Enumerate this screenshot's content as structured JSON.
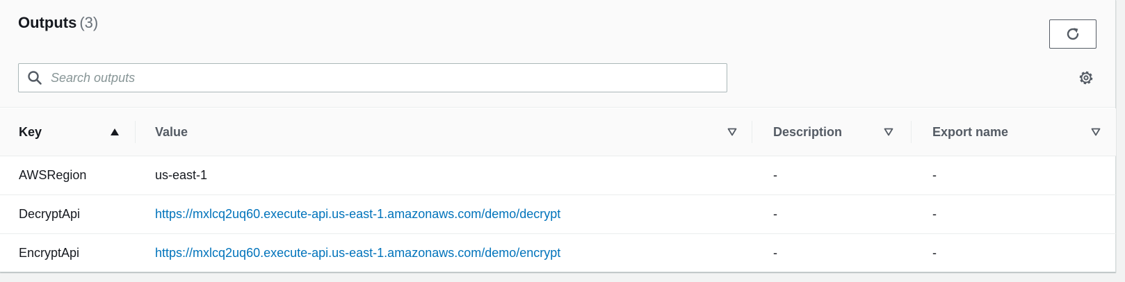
{
  "header": {
    "title": "Outputs",
    "count": "(3)",
    "refresh_icon": "refresh-icon",
    "settings_icon": "gear-icon"
  },
  "search": {
    "placeholder": "Search outputs",
    "value": "",
    "icon": "search-icon"
  },
  "table": {
    "columns": [
      {
        "label": "Key",
        "sort": "ascending"
      },
      {
        "label": "Value",
        "sort": "none"
      },
      {
        "label": "Description",
        "sort": "none"
      },
      {
        "label": "Export name",
        "sort": "none"
      }
    ],
    "rows": [
      {
        "key": "AWSRegion",
        "value": "us-east-1",
        "description": "-",
        "export_name": "-"
      },
      {
        "key": "DecryptApi",
        "value": "https://mxlcq2uq60.execute-api.us-east-1.amazonaws.com/demo/decrypt",
        "description": "-",
        "export_name": "-"
      },
      {
        "key": "EncryptApi",
        "value": "https://mxlcq2uq60.execute-api.us-east-1.amazonaws.com/demo/encrypt",
        "description": "-",
        "export_name": "-"
      }
    ]
  },
  "colors": {
    "link": "#0073bb",
    "text": "#16191f",
    "muted": "#545b64",
    "placeholder": "#879596",
    "border": "#aab7b8",
    "header_bg": "#fafafa"
  }
}
